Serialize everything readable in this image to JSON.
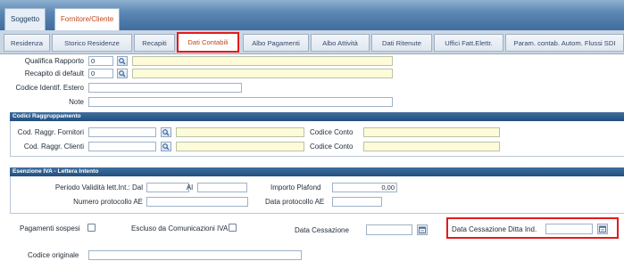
{
  "main_tabs": [
    {
      "label": "Soggetto"
    },
    {
      "label": "Fornitore/Cliente"
    }
  ],
  "sub_tabs": [
    {
      "label": "Residenza"
    },
    {
      "label": "Storico Residenze"
    },
    {
      "label": "Recapiti"
    },
    {
      "label": "Dati Contabili"
    },
    {
      "label": "Albo Pagamenti"
    },
    {
      "label": "Albo Attività"
    },
    {
      "label": "Dati Ritenute"
    },
    {
      "label": "Uffici Fatt.Elettr."
    },
    {
      "label": "Param. contab. Autom. Flussi SDI"
    }
  ],
  "general": {
    "qualifica_label": "Qualifica Rapporto",
    "qualifica_value": "0",
    "recapito_label": "Recapito di default",
    "recapito_value": "0",
    "codice_estero_label": "Codice Identif. Estero",
    "note_label": "Note"
  },
  "raggruppamento": {
    "title": "Codici Raggruppamento",
    "fornitori_label": "Cod. Raggr. Fornitori",
    "clienti_label": "Cod. Raggr. Clienti",
    "codice_conto_label": "Codice Conto"
  },
  "esenzione": {
    "title": "Esenzione IVA - Lettera Intento",
    "periodo_label": "Periodo Validità lett.Int.: Dal",
    "al_label": "Al",
    "importo_label": "Importo Plafond",
    "importo_value": "0,00",
    "numero_label": "Numero protocollo AE",
    "data_label": "Data protocollo AE"
  },
  "bottom": {
    "pagamenti_label": "Pagamenti sospesi",
    "escluso_label": "Escluso da Comunicazioni IVA",
    "data_cessazione_label": "Data Cessazione",
    "data_cessazione_ditta_label": "Data Cessazione Ditta Ind.",
    "codice_originale_label": "Codice originale"
  },
  "colors": {
    "highlight": "#e31b1b",
    "required_field": "#fefcd8",
    "section_header": "#2c5a8a",
    "active_tab_text": "#c2471c"
  }
}
